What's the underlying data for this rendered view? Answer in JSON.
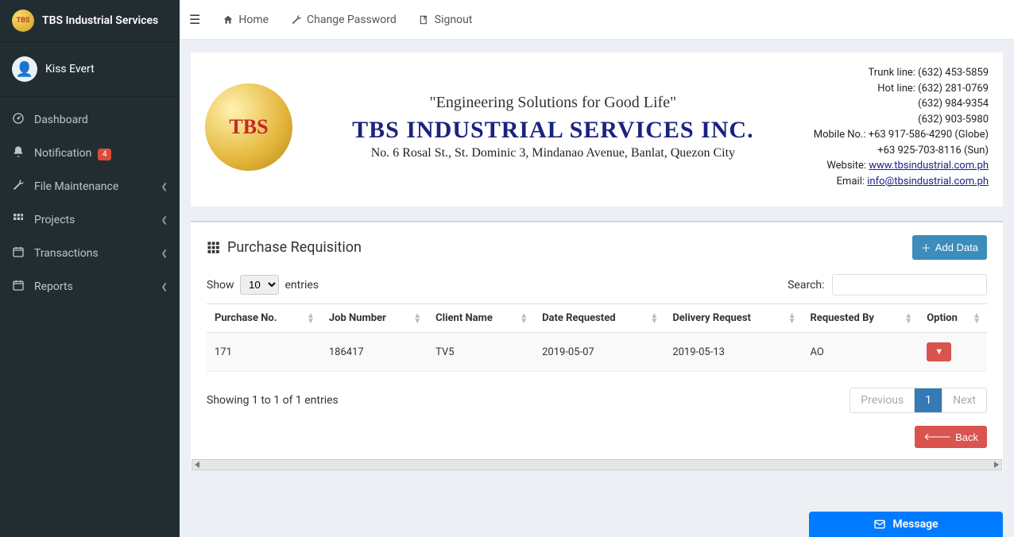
{
  "app": {
    "title": "TBS Industrial Services",
    "logo_text": "TBS"
  },
  "user": {
    "name": "Kiss Evert"
  },
  "sidebar": {
    "items": [
      {
        "icon": "dashboard",
        "label": "Dashboard",
        "has_chevron": false
      },
      {
        "icon": "bell",
        "label": "Notification",
        "badge": "4",
        "has_chevron": false
      },
      {
        "icon": "wrench",
        "label": "File Maintenance",
        "has_chevron": true
      },
      {
        "icon": "grid",
        "label": "Projects",
        "has_chevron": true
      },
      {
        "icon": "calendar",
        "label": "Transactions",
        "has_chevron": true
      },
      {
        "icon": "calendar",
        "label": "Reports",
        "has_chevron": true
      }
    ]
  },
  "topbar": {
    "home": "Home",
    "change_password": "Change Password",
    "signout": "Signout"
  },
  "banner": {
    "logo_text": "TBS",
    "tagline": "\"Engineering Solutions for Good Life\"",
    "company": "TBS INDUSTRIAL SERVICES INC.",
    "address": "No. 6 Rosal St., St. Dominic 3, Mindanao Avenue, Banlat, Quezon City",
    "trunk_line": "Trunk line: (632) 453-5859",
    "hot_line": "Hot line: (632) 281-0769",
    "phone3": "(632) 984-9354",
    "phone4": "(632) 903-5980",
    "mobile1": "Mobile No.: +63 917-586-4290 (Globe)",
    "mobile2": "+63 925-703-8116 (Sun)",
    "website_label": "Website:",
    "website": "www.tbsindustrial.com.ph",
    "email_label": "Email:",
    "email": "info@tbsindustrial.com.ph"
  },
  "panel": {
    "title": "Purchase Requisition",
    "add_btn": "Add Data",
    "show_label": "Show",
    "entries_label": "entries",
    "page_size": "10",
    "search_label": "Search:",
    "columns": [
      "Purchase No.",
      "Job Number",
      "Client Name",
      "Date Requested",
      "Delivery Request",
      "Requested By",
      "Option"
    ],
    "rows": [
      {
        "purchase_no": "171",
        "job_number": "186417",
        "client_name": "TV5",
        "date_requested": "2019-05-07",
        "delivery_request": "2019-05-13",
        "requested_by": "AO"
      }
    ],
    "info": "Showing 1 to 1 of 1 entries",
    "prev": "Previous",
    "page": "1",
    "next": "Next",
    "back": "Back"
  },
  "message_bar": {
    "label": "Message"
  }
}
